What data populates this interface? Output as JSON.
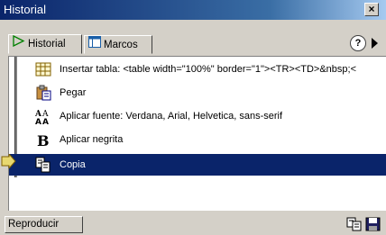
{
  "window": {
    "title": "Historial",
    "close_glyph": "×"
  },
  "tabs": [
    {
      "label": "Historial",
      "icon": "play-arrow-icon",
      "active": true
    },
    {
      "label": "Marcos",
      "icon": "frames-icon",
      "active": false
    }
  ],
  "toolbar": {
    "help_glyph": "?"
  },
  "history": {
    "items": [
      {
        "label": "Insertar tabla: <table width=\"100%\" border=\"1\"><TR><TD>&nbsp;<",
        "icon": "table-icon",
        "selected": false
      },
      {
        "label": "Pegar",
        "icon": "paste-icon",
        "selected": false
      },
      {
        "label": "Aplicar fuente: Verdana, Arial, Helvetica, sans-serif",
        "icon": "font-icon",
        "selected": false
      },
      {
        "label": "Aplicar negrita",
        "icon": "bold-icon",
        "selected": false
      },
      {
        "label": "Copia",
        "icon": "copy-icon",
        "selected": true
      }
    ]
  },
  "footer": {
    "replay_label": "Reproducir",
    "copy_steps_icon": "copy-steps-icon",
    "save_command_icon": "save-icon"
  },
  "colors": {
    "selection": "#0a246a",
    "panel": "#d4d0c8",
    "titlebar_start": "#0a246a"
  }
}
